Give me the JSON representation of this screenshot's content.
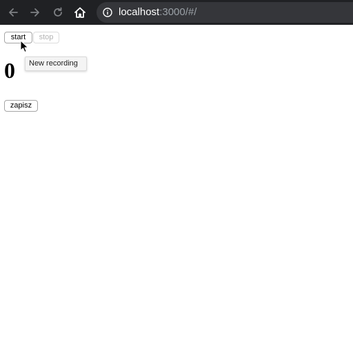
{
  "browser": {
    "url_host": "localhost",
    "url_rest": ":3000/#/",
    "icons": {
      "back": "arrow-left-icon",
      "forward": "arrow-right-icon",
      "reload": "reload-icon",
      "home": "home-icon",
      "site_info": "info-icon"
    }
  },
  "page": {
    "start_label": "start",
    "stop_label": "stop",
    "counter_value": "0",
    "save_label": "zapisz",
    "tooltip_text": "New recording"
  },
  "colors": {
    "toolbar_bg": "#202124",
    "omnibox_bg": "#35363a",
    "page_bg": "#ffffff"
  }
}
